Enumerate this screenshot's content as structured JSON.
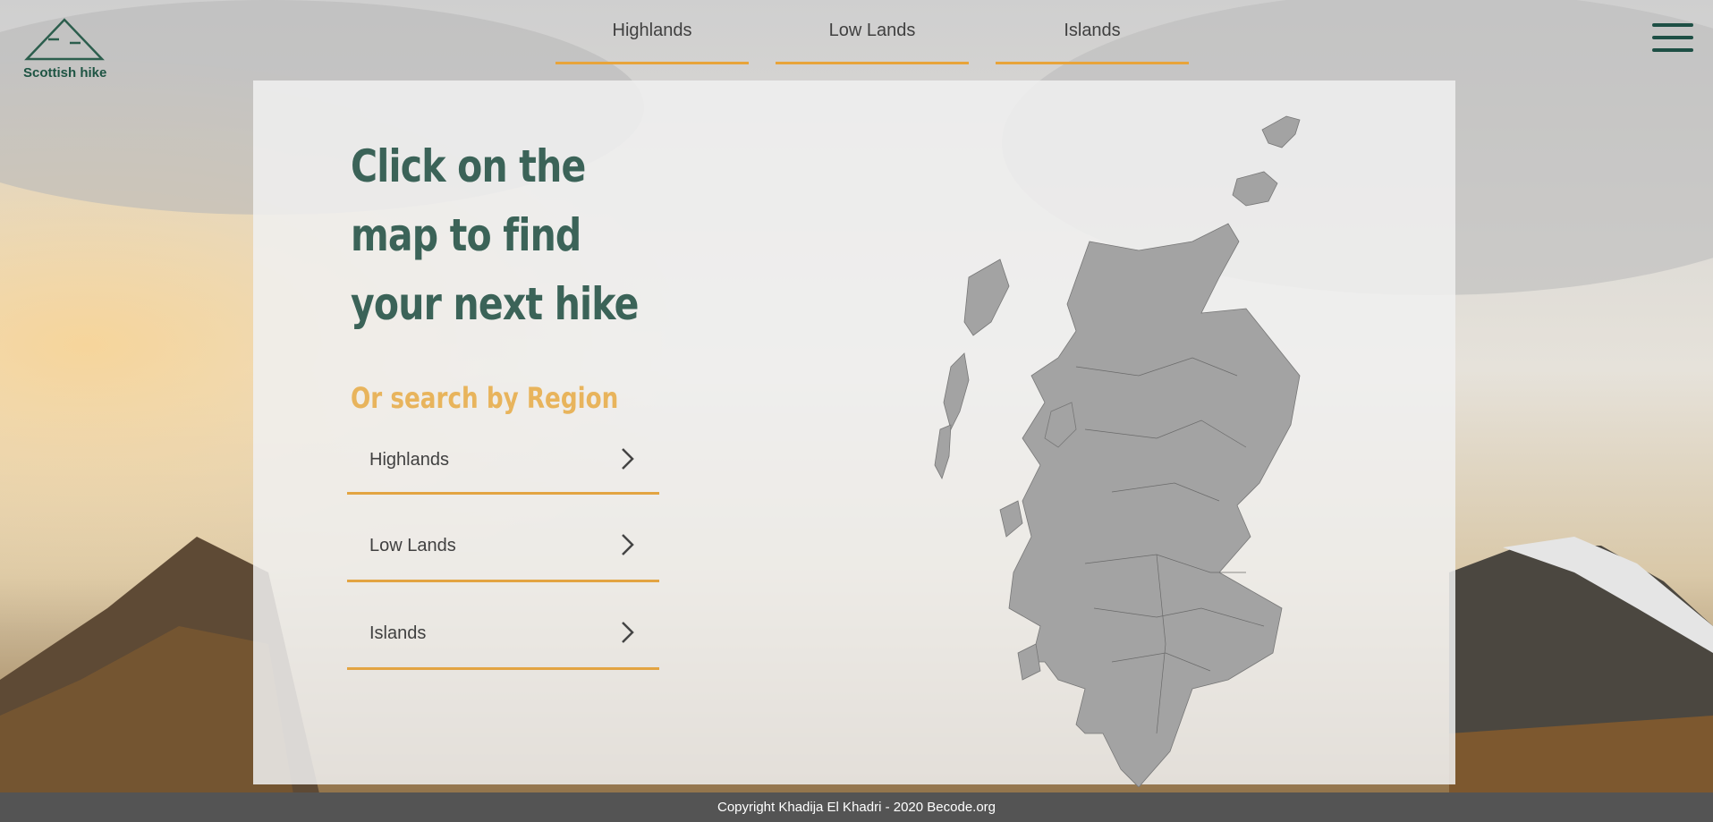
{
  "logo": {
    "text": "Scottish hike",
    "icon": "mountain-icon"
  },
  "nav": {
    "items": [
      "Highlands",
      "Low Lands",
      "Islands"
    ]
  },
  "menu": {
    "icon": "hamburger-icon"
  },
  "main": {
    "headline": "Click on the map to find your next hike",
    "subheading": "Or search by Region",
    "regions": [
      {
        "label": "Highlands",
        "icon": "chevron-right-icon"
      },
      {
        "label": "Low Lands",
        "icon": "chevron-right-icon"
      },
      {
        "label": "Islands",
        "icon": "chevron-right-icon"
      }
    ],
    "map_icon": "scotland-map-icon"
  },
  "footer": {
    "text": "Copyright Khadija El Khadri - 2020 Becode.org"
  },
  "colors": {
    "brand_green": "#3b6358",
    "accent_orange": "#e8a43a",
    "subheading_orange": "#e8b45c",
    "footer_bg": "#545454"
  }
}
